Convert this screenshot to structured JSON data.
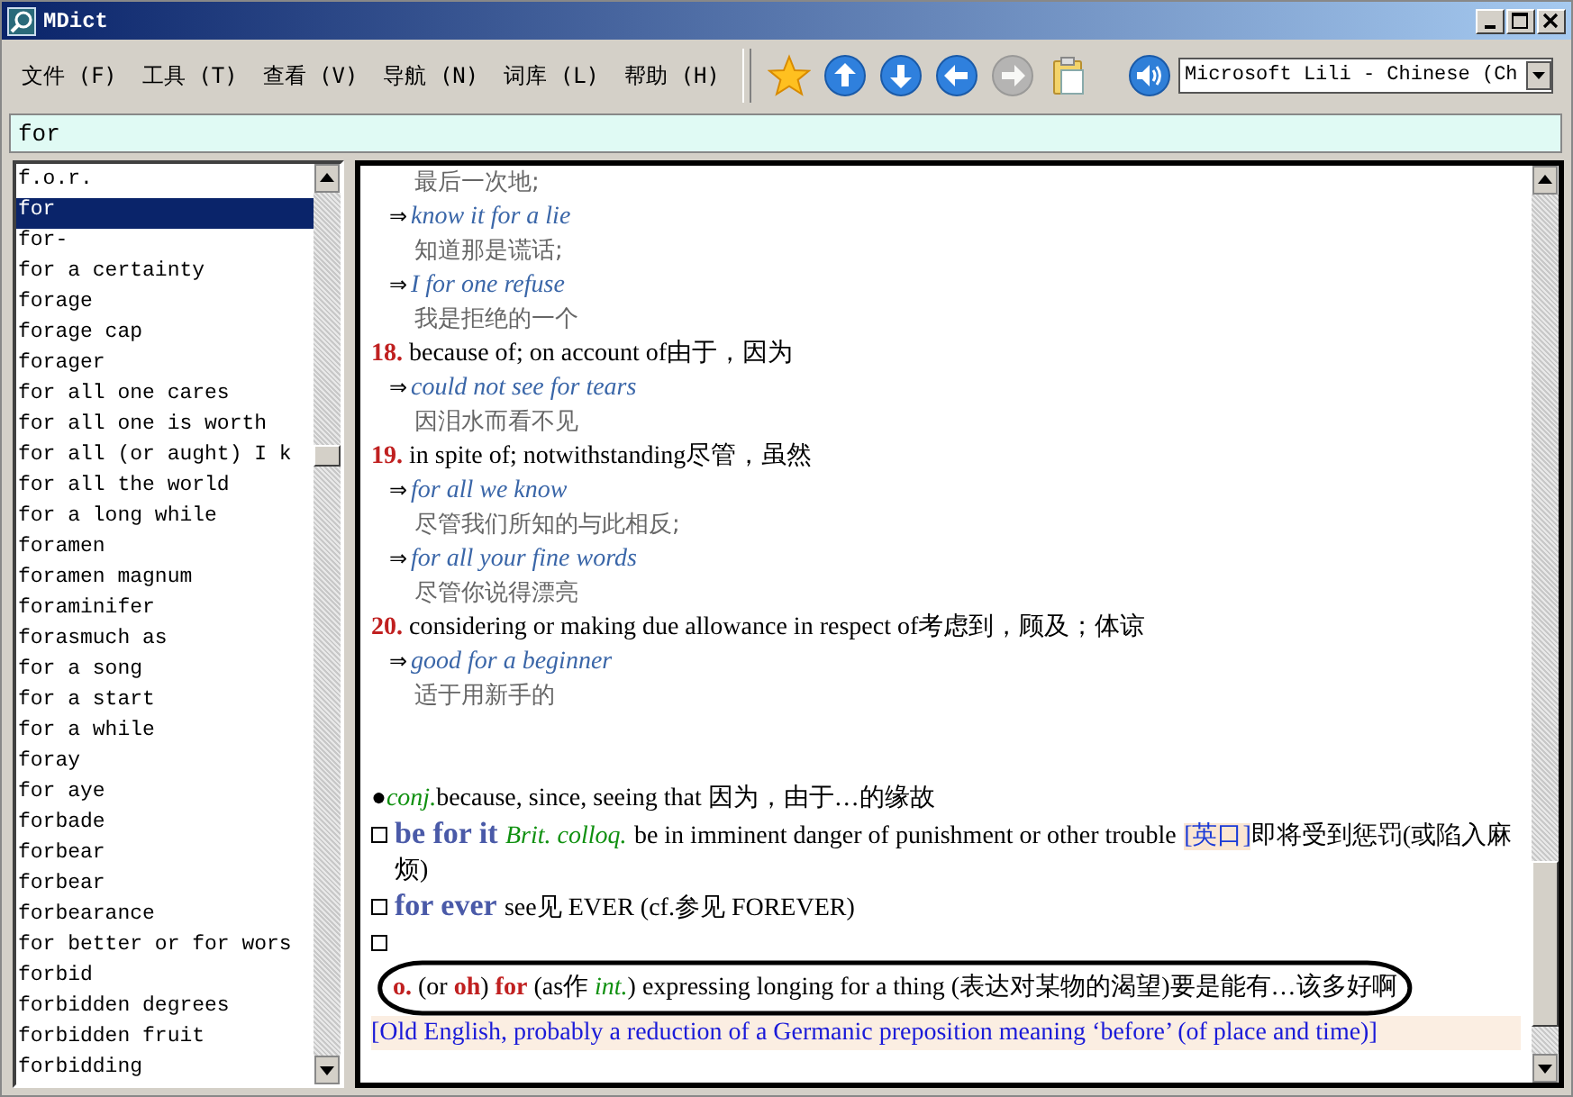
{
  "window": {
    "title": "MDict"
  },
  "menu": [
    "文件 (F)",
    "工具 (T)",
    "查看 (V)",
    "导航 (N)",
    "词库 (L)",
    "帮助 (H)"
  ],
  "toolbar": [
    {
      "kind": "star",
      "disabled": false
    },
    {
      "kind": "up",
      "disabled": false
    },
    {
      "kind": "down",
      "disabled": false
    },
    {
      "kind": "left",
      "disabled": false
    },
    {
      "kind": "right",
      "disabled": true
    },
    {
      "kind": "clipboard",
      "disabled": false
    },
    {
      "kind": "speaker",
      "disabled": false
    }
  ],
  "voice": {
    "value": "Microsoft Lili - Chinese (Ch"
  },
  "search": {
    "value": "for"
  },
  "words": [
    {
      "text": "f.o.r.",
      "selected": false
    },
    {
      "text": "for",
      "selected": true
    },
    {
      "text": "for-",
      "selected": false
    },
    {
      "text": "for a certainty",
      "selected": false
    },
    {
      "text": "forage",
      "selected": false
    },
    {
      "text": "forage cap",
      "selected": false
    },
    {
      "text": "forager",
      "selected": false
    },
    {
      "text": "for all one cares",
      "selected": false
    },
    {
      "text": "for all one is worth",
      "selected": false
    },
    {
      "text": "for all (or aught) I k",
      "selected": false
    },
    {
      "text": "for all the world",
      "selected": false
    },
    {
      "text": "for a long while",
      "selected": false
    },
    {
      "text": "foramen",
      "selected": false
    },
    {
      "text": "foramen magnum",
      "selected": false
    },
    {
      "text": "foraminifer",
      "selected": false
    },
    {
      "text": "forasmuch as",
      "selected": false
    },
    {
      "text": "for a song",
      "selected": false
    },
    {
      "text": "for a start",
      "selected": false
    },
    {
      "text": "for a while",
      "selected": false
    },
    {
      "text": "foray",
      "selected": false
    },
    {
      "text": "for aye",
      "selected": false
    },
    {
      "text": "forbade",
      "selected": false
    },
    {
      "text": "forbear",
      "selected": false
    },
    {
      "text": "forbear",
      "selected": false
    },
    {
      "text": "forbearance",
      "selected": false
    },
    {
      "text": "for better or for wors",
      "selected": false
    },
    {
      "text": "forbid",
      "selected": false
    },
    {
      "text": "forbidden degrees",
      "selected": false
    },
    {
      "text": "forbidden fruit",
      "selected": false
    },
    {
      "text": "forbidding",
      "selected": false
    }
  ],
  "entry": [
    {
      "kind": "cn",
      "text": "最后一次地;"
    },
    {
      "kind": "example",
      "arrow": "⇒",
      "text": "know it for a lie"
    },
    {
      "kind": "cn",
      "text": "知道那是谎话;"
    },
    {
      "kind": "example",
      "arrow": "⇒",
      "text": "I for one refuse"
    },
    {
      "kind": "cn",
      "text": "我是拒绝的一个"
    },
    {
      "kind": "sense",
      "num": "18.",
      "text": "because of; on account of由于，因为"
    },
    {
      "kind": "example",
      "arrow": "⇒",
      "text": "could not see for tears"
    },
    {
      "kind": "cn",
      "text": "因泪水而看不见"
    },
    {
      "kind": "sense",
      "num": "19.",
      "text": "in spite of; notwithstanding尽管，虽然"
    },
    {
      "kind": "example",
      "arrow": "⇒",
      "text": "for all we know"
    },
    {
      "kind": "cn",
      "text": "尽管我们所知的与此相反;"
    },
    {
      "kind": "example",
      "arrow": "⇒",
      "text": "for all your fine words"
    },
    {
      "kind": "cn",
      "text": "尽管你说得漂亮"
    },
    {
      "kind": "sense",
      "num": "20.",
      "text": "considering or making due allowance in respect of考虑到，顾及；体谅"
    },
    {
      "kind": "example",
      "arrow": "⇒",
      "text": "good for a beginner"
    },
    {
      "kind": "cn",
      "text": "适于用新手的"
    },
    {
      "kind": "blank"
    },
    {
      "kind": "blank"
    },
    {
      "kind": "pos",
      "bullet": "●",
      "pos": "conj.",
      "text": "because, since, seeing that 因为，由于…的缘故"
    },
    {
      "kind": "phrase",
      "head": "be for it",
      "label": "Brit. colloq.",
      "text": "be in imminent danger of punishment or other trouble",
      "tag": "[英口]",
      "rest": "即将受到惩罚(或陷入麻烦)"
    },
    {
      "kind": "phrase",
      "head": "for ever",
      "text": "see见 EVER (cf.参见 FOREVER)"
    },
    {
      "kind": "box"
    },
    {
      "kind": "mixed",
      "parts": [
        {
          "kind": "mark",
          "text": "o."
        },
        {
          "kind": "text",
          "text": " (or "
        },
        {
          "kind": "mark",
          "text": "oh"
        },
        {
          "kind": "text",
          "text": ") "
        },
        {
          "kind": "mark",
          "text": "for"
        },
        {
          "kind": "text",
          "text": " (as作 "
        },
        {
          "kind": "label",
          "text": "int."
        },
        {
          "kind": "text",
          "text": ") expressing longing for a thing (表达对某物的渴望)要是能有…该多好啊"
        }
      ]
    },
    {
      "kind": "etym",
      "text": "[Old English, probably a reduction of a Germanic preposition meaning ‘before’ (of place and time)]"
    }
  ]
}
